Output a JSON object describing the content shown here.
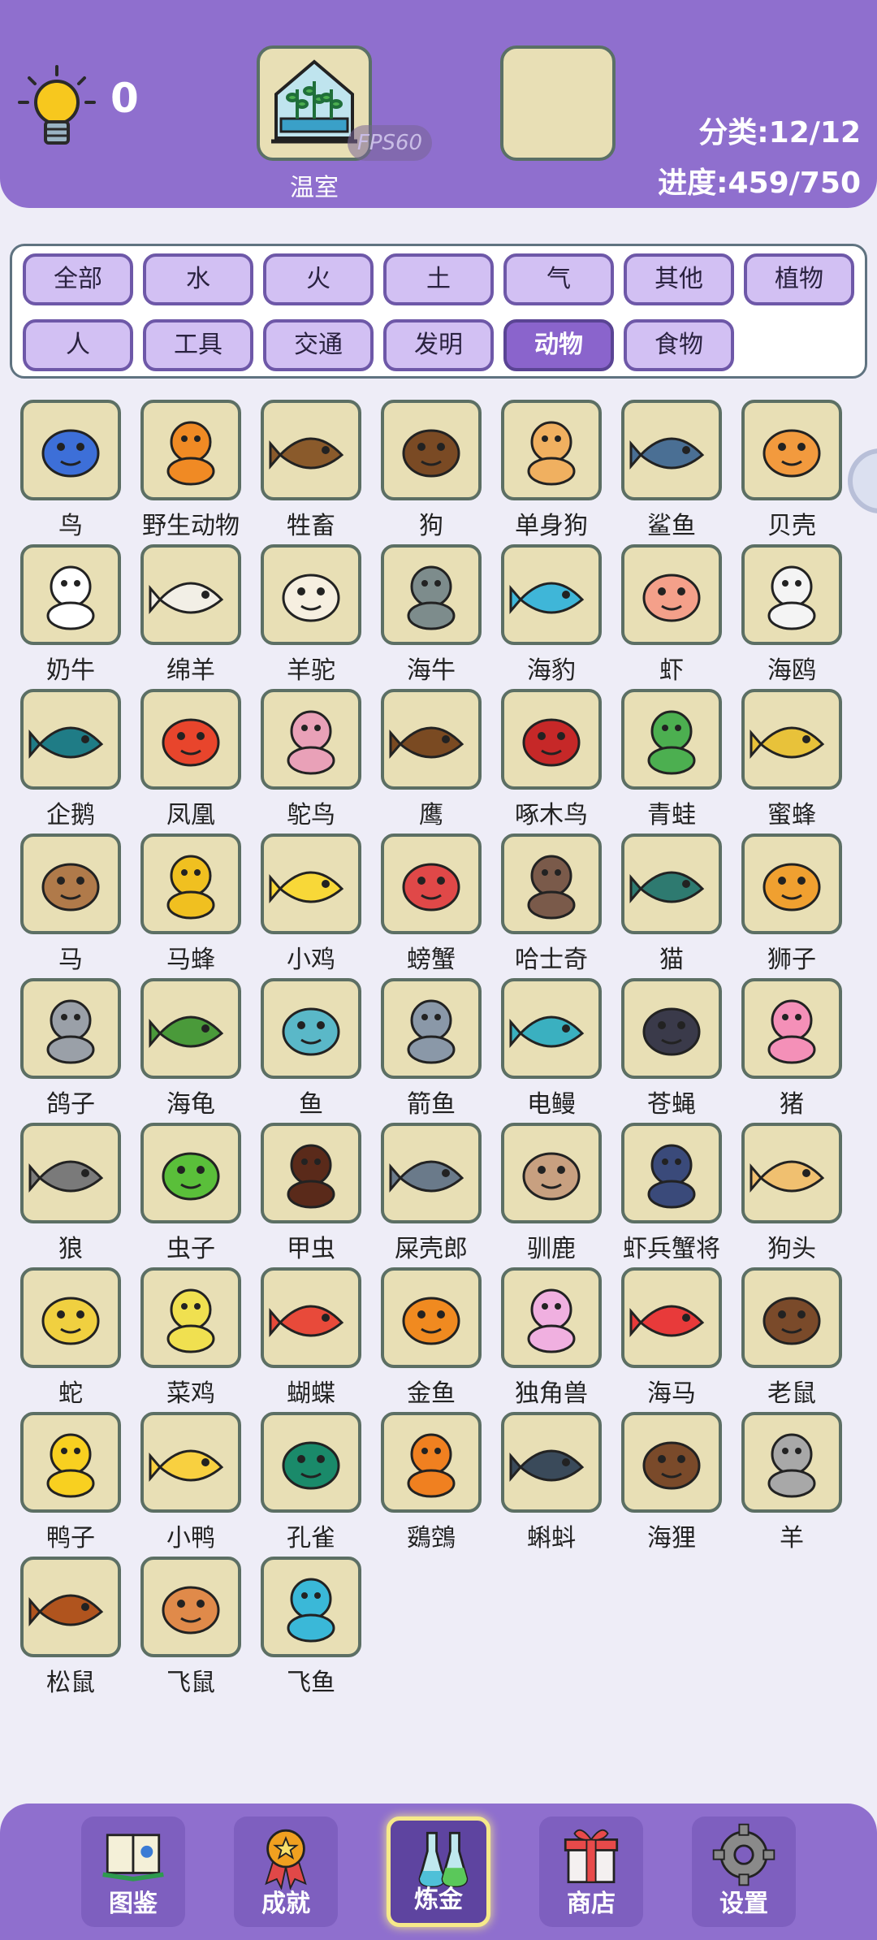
{
  "header": {
    "hint_count": "0",
    "slot1_label": "温室",
    "fps_text": "FPS60",
    "category_stat": "分类:12/12",
    "progress_stat": "进度:459/750"
  },
  "categories": [
    "全部",
    "水",
    "火",
    "土",
    "气",
    "其他",
    "植物",
    "人",
    "工具",
    "交通",
    "发明",
    "动物",
    "食物"
  ],
  "active_category": "动物",
  "items": [
    {
      "label": "鸟",
      "icon": "bird-icon",
      "color": "#3d6fd8"
    },
    {
      "label": "野生动物",
      "icon": "tiger-icon",
      "color": "#f08a24"
    },
    {
      "label": "牲畜",
      "icon": "ox-icon",
      "color": "#8a5a2b"
    },
    {
      "label": "狗",
      "icon": "dog-icon",
      "color": "#7a4a24"
    },
    {
      "label": "单身狗",
      "icon": "shiba-icon",
      "color": "#f0b060"
    },
    {
      "label": "鲨鱼",
      "icon": "shark-icon",
      "color": "#4a6f94"
    },
    {
      "label": "贝壳",
      "icon": "shell-icon",
      "color": "#f29a3e"
    },
    {
      "label": "奶牛",
      "icon": "cow-icon",
      "color": "#ffffff"
    },
    {
      "label": "绵羊",
      "icon": "sheep-icon",
      "color": "#f2efe6"
    },
    {
      "label": "羊驼",
      "icon": "alpaca-icon",
      "color": "#f6efe0"
    },
    {
      "label": "海牛",
      "icon": "manatee-icon",
      "color": "#7d8c8c"
    },
    {
      "label": "海豹",
      "icon": "seal-icon",
      "color": "#3fb6d8"
    },
    {
      "label": "虾",
      "icon": "shrimp-icon",
      "color": "#f4a08a"
    },
    {
      "label": "海鸥",
      "icon": "seagull-icon",
      "color": "#f4f4f4"
    },
    {
      "label": "企鹅",
      "icon": "penguin-icon",
      "color": "#1f7c86"
    },
    {
      "label": "凤凰",
      "icon": "phoenix-icon",
      "color": "#e8452c"
    },
    {
      "label": "鸵鸟",
      "icon": "ostrich-icon",
      "color": "#e9a1b8"
    },
    {
      "label": "鹰",
      "icon": "eagle-icon",
      "color": "#7a4a22"
    },
    {
      "label": "啄木鸟",
      "icon": "woodpecker-icon",
      "color": "#c62828"
    },
    {
      "label": "青蛙",
      "icon": "frog-icon",
      "color": "#4caf50"
    },
    {
      "label": "蜜蜂",
      "icon": "bee-icon",
      "color": "#e8c23a"
    },
    {
      "label": "马",
      "icon": "horse-icon",
      "color": "#b07a4a"
    },
    {
      "label": "马蜂",
      "icon": "hornet-icon",
      "color": "#f0c020"
    },
    {
      "label": "小鸡",
      "icon": "chick-icon",
      "color": "#f8d838"
    },
    {
      "label": "螃蟹",
      "icon": "crab-icon",
      "color": "#e04848"
    },
    {
      "label": "哈士奇",
      "icon": "husky-icon",
      "color": "#7a5a4a"
    },
    {
      "label": "猫",
      "icon": "cat-icon",
      "color": "#2e7a70"
    },
    {
      "label": "狮子",
      "icon": "lion-icon",
      "color": "#f0a030"
    },
    {
      "label": "鸽子",
      "icon": "pigeon-icon",
      "color": "#9aa0a8"
    },
    {
      "label": "海龟",
      "icon": "turtle-icon",
      "color": "#4a9a3a"
    },
    {
      "label": "鱼",
      "icon": "fish-icon",
      "color": "#5ab8c8"
    },
    {
      "label": "箭鱼",
      "icon": "swordfish-icon",
      "color": "#8a98a8"
    },
    {
      "label": "电鳗",
      "icon": "eel-icon",
      "color": "#3ab0c0"
    },
    {
      "label": "苍蝇",
      "icon": "fly-icon",
      "color": "#3a3a4a"
    },
    {
      "label": "猪",
      "icon": "pig-icon",
      "color": "#f490b8"
    },
    {
      "label": "狼",
      "icon": "wolf-icon",
      "color": "#7a7a7a"
    },
    {
      "label": "虫子",
      "icon": "caterpillar-icon",
      "color": "#5abf3a"
    },
    {
      "label": "甲虫",
      "icon": "beetle-icon",
      "color": "#5a2a1a"
    },
    {
      "label": "屎壳郎",
      "icon": "dung-beetle-icon",
      "color": "#6a7a8a"
    },
    {
      "label": "驯鹿",
      "icon": "reindeer-icon",
      "color": "#c8a080"
    },
    {
      "label": "虾兵蟹将",
      "icon": "warriors-icon",
      "color": "#3a4a7a"
    },
    {
      "label": "狗头",
      "icon": "doge-icon",
      "color": "#f0c070"
    },
    {
      "label": "蛇",
      "icon": "snake-icon",
      "color": "#f0d040"
    },
    {
      "label": "菜鸡",
      "icon": "noob-chick-icon",
      "color": "#f0e050"
    },
    {
      "label": "蝴蝶",
      "icon": "butterfly-icon",
      "color": "#e84a3a"
    },
    {
      "label": "金鱼",
      "icon": "goldfish-icon",
      "color": "#f08a20"
    },
    {
      "label": "独角兽",
      "icon": "unicorn-icon",
      "color": "#f0b0e0"
    },
    {
      "label": "海马",
      "icon": "seahorse-icon",
      "color": "#e83a3a"
    },
    {
      "label": "老鼠",
      "icon": "rat-icon",
      "color": "#7a4a2a"
    },
    {
      "label": "鸭子",
      "icon": "duck-icon",
      "color": "#f8d020"
    },
    {
      "label": "小鸭",
      "icon": "duckling-icon",
      "color": "#f8d040"
    },
    {
      "label": "孔雀",
      "icon": "peacock-icon",
      "color": "#1a8a6a"
    },
    {
      "label": "鵎鵼",
      "icon": "toucan-icon",
      "color": "#f08020"
    },
    {
      "label": "蝌蚪",
      "icon": "tadpole-icon",
      "color": "#3a4a5a"
    },
    {
      "label": "海狸",
      "icon": "beaver-icon",
      "color": "#7a4a2a"
    },
    {
      "label": "羊",
      "icon": "goat-icon",
      "color": "#a8a8a8"
    },
    {
      "label": "松鼠",
      "icon": "squirrel-icon",
      "color": "#b0541e"
    },
    {
      "label": "飞鼠",
      "icon": "flying-squirrel-icon",
      "color": "#e08a4a"
    },
    {
      "label": "飞鱼",
      "icon": "flying-fish-icon",
      "color": "#3ab8d8"
    }
  ],
  "nav": [
    {
      "label": "图鉴",
      "icon": "book-icon"
    },
    {
      "label": "成就",
      "icon": "medal-icon"
    },
    {
      "label": "炼金",
      "icon": "flask-icon"
    },
    {
      "label": "商店",
      "icon": "gift-icon"
    },
    {
      "label": "设置",
      "icon": "gear-icon"
    }
  ],
  "active_nav": "炼金"
}
